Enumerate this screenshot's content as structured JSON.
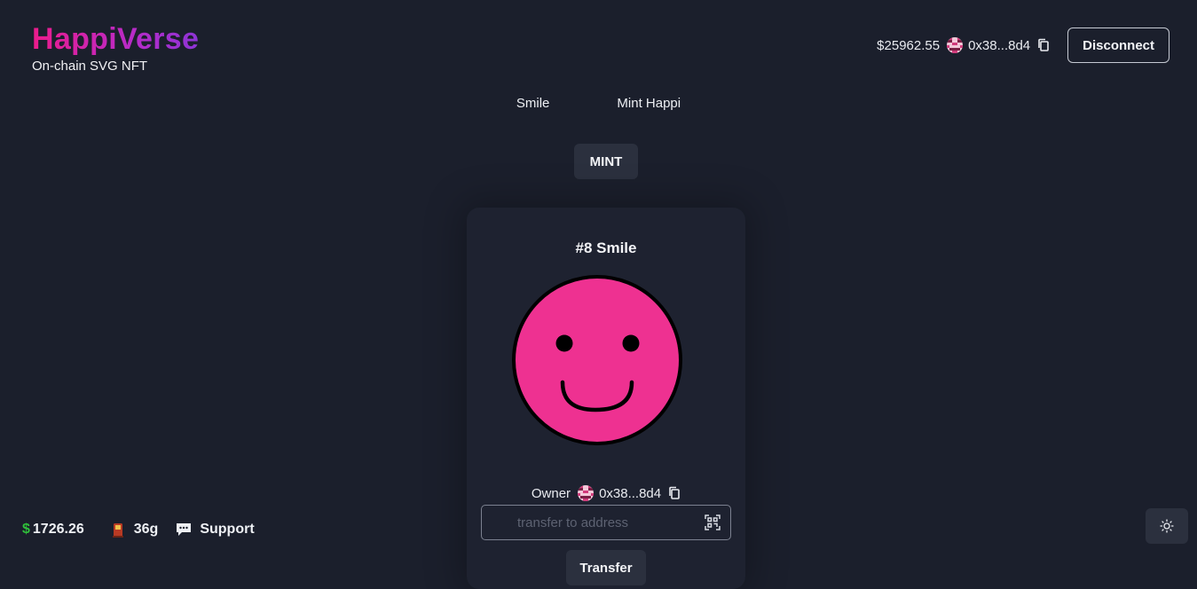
{
  "header": {
    "app_title": "HappiVerse",
    "subtitle": "On-chain SVG NFT",
    "balance": "$25962.55",
    "address": "0x38...8d4",
    "disconnect_label": "Disconnect"
  },
  "nav": {
    "items": [
      {
        "label": "Smile"
      },
      {
        "label": "Mint Happi"
      }
    ]
  },
  "mint": {
    "label": "MINT"
  },
  "card": {
    "title": "#8 Smile",
    "face_color": "#ee3191",
    "owner_label": "Owner",
    "owner_address": "0x38...8d4",
    "transfer_placeholder": "transfer to address",
    "transfer_label": "Transfer"
  },
  "footer": {
    "price": "1726.26",
    "gas": "36g",
    "support_label": "Support"
  },
  "icons": [
    "copy-icon",
    "qr-scan-icon",
    "gas-pump-icon",
    "chat-icon",
    "sun-icon",
    "blockie-avatar"
  ],
  "colors": {
    "background": "#1b1f2c",
    "brand_pink": "#ec1b8b",
    "brand_purple": "#8e34d6",
    "price_green": "#2fbf3a"
  }
}
